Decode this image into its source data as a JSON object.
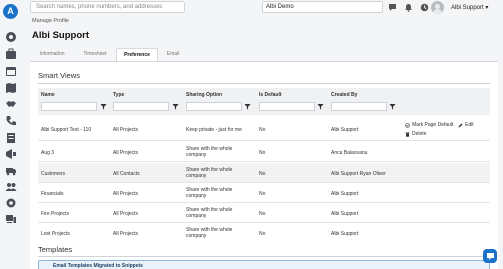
{
  "header": {
    "search_placeholder": "Search names, phone numbers, and addresses",
    "organization": "Albi Demo",
    "user_name": "Albi Support",
    "user_caret": "▾",
    "logo_letter": "A"
  },
  "breadcrumb": "Manage Profile",
  "page_title": "Albi Support",
  "tabs": [
    {
      "label": "Information",
      "active": false
    },
    {
      "label": "Timesheet",
      "active": false
    },
    {
      "label": "Preference",
      "active": true
    },
    {
      "label": "Email",
      "active": false
    }
  ],
  "smart_views": {
    "title": "Smart Views",
    "columns": [
      "Name",
      "Type",
      "Sharing Option",
      "Is Default",
      "Created By"
    ],
    "row_actions": {
      "mark_default": "Mark Page Default",
      "edit": "Edit",
      "delete": "Delete"
    },
    "rows": [
      {
        "name": "Albi Support Test - 110",
        "type": "All Projects",
        "sharing": [
          "Keep private - just for me"
        ],
        "is_default": "No",
        "created_by": "Albi Support"
      },
      {
        "name": "Aug 3",
        "type": "All Projects",
        "sharing": [
          "Share with the whole",
          "company"
        ],
        "is_default": "No",
        "created_by": "Anca Balaceanu"
      },
      {
        "name": "Customers",
        "type": "All Contacts",
        "sharing": [
          "Share with the whole",
          "company"
        ],
        "is_default": "No",
        "created_by": "Albi Support Ryan Oliver"
      },
      {
        "name": "Financials",
        "type": "All Projects",
        "sharing": [
          "Share with the whole",
          "company"
        ],
        "is_default": "No",
        "created_by": "Albi Support"
      },
      {
        "name": "Fire Projects",
        "type": "All Projects",
        "sharing": [
          "Share with the whole",
          "company"
        ],
        "is_default": "No",
        "created_by": "Albi Support"
      },
      {
        "name": "Lost Projects",
        "type": "All Projects",
        "sharing": [
          "Share with the whole",
          "company"
        ],
        "is_default": "No",
        "created_by": "Albi Support"
      }
    ]
  },
  "templates": {
    "title": "Templates",
    "banner": "Email Templates Migrated to Snippets"
  },
  "colors": {
    "brand": "#1a73c9",
    "panel_bg": "#ffffff",
    "page_bg": "#f4f5f7"
  }
}
